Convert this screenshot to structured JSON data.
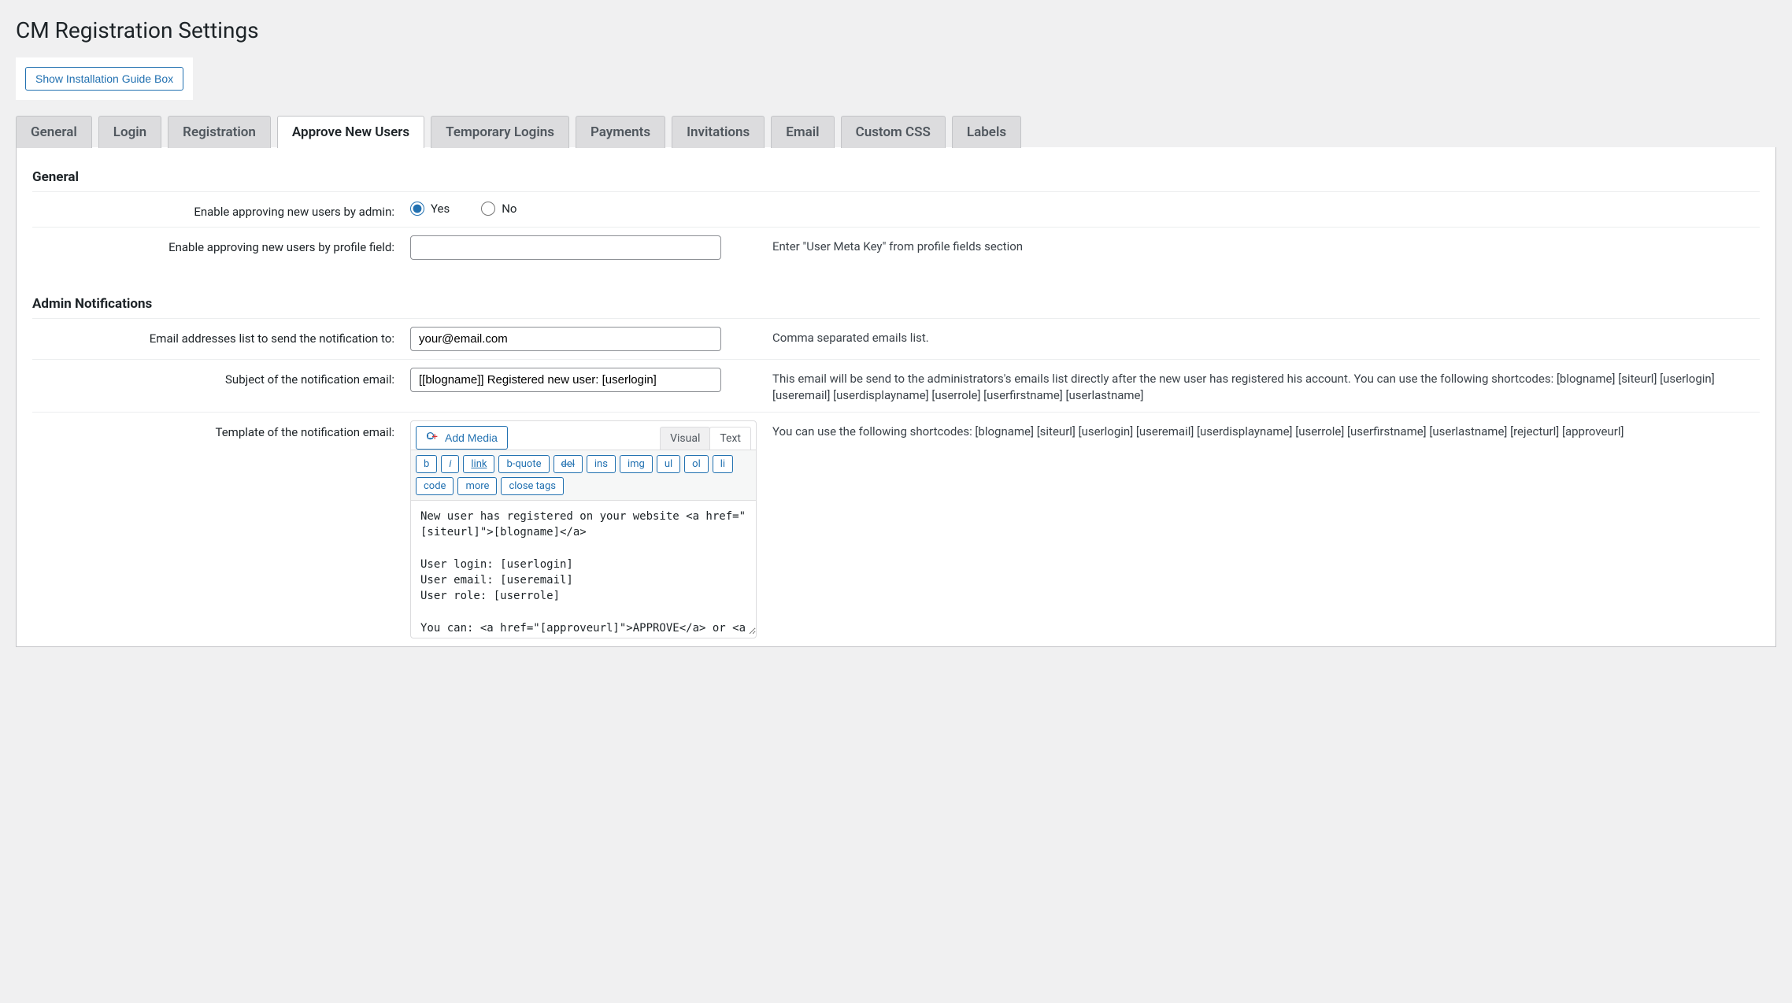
{
  "page_title": "CM Registration Settings",
  "guide_button": "Show Installation Guide Box",
  "tabs": [
    {
      "label": "General"
    },
    {
      "label": "Login"
    },
    {
      "label": "Registration"
    },
    {
      "label": "Approve New Users",
      "active": true
    },
    {
      "label": "Temporary Logins"
    },
    {
      "label": "Payments"
    },
    {
      "label": "Invitations"
    },
    {
      "label": "Email"
    },
    {
      "label": "Custom CSS"
    },
    {
      "label": "Labels"
    }
  ],
  "sections": {
    "general": {
      "title": "General",
      "enable_admin_label": "Enable approving new users by admin:",
      "yes": "Yes",
      "no": "No",
      "enable_profile_label": "Enable approving new users by profile field:",
      "enable_profile_value": "",
      "enable_profile_help": "Enter \"User Meta Key\" from profile fields section"
    },
    "admin_notifications": {
      "title": "Admin Notifications",
      "emails_label": "Email addresses list to send the notification to:",
      "emails_value": "your@email.com",
      "emails_help": "Comma separated emails list.",
      "subject_label": "Subject of the notification email:",
      "subject_value": "[[blogname]] Registered new user: [userlogin]",
      "subject_help": "This email will be send to the administrators's emails list directly after the new user has registered his account. You can use the following shortcodes: [blogname] [siteurl] [userlogin] [useremail] [userdisplayname] [userrole] [userfirstname] [userlastname]",
      "template_label": "Template of the notification email:",
      "template_help": "You can use the following shortcodes: [blogname] [siteurl] [userlogin] [useremail] [userdisplayname] [userrole] [userfirstname] [userlastname] [rejecturl] [approveurl]"
    }
  },
  "editor": {
    "add_media": "Add Media",
    "visual": "Visual",
    "text": "Text",
    "quicktags": {
      "b": "b",
      "i": "i",
      "link": "link",
      "bquote": "b-quote",
      "del": "del",
      "ins": "ins",
      "img": "img",
      "ul": "ul",
      "ol": "ol",
      "li": "li",
      "code": "code",
      "more": "more",
      "close": "close tags"
    },
    "content": "New user has registered on your website <a href=\"[siteurl]\">[blogname]</a>\n\nUser login: [userlogin]\nUser email: [useremail]\nUser role: [userrole]\n\nYou can: <a href=\"[approveurl]\">APPROVE</a> or <a"
  }
}
